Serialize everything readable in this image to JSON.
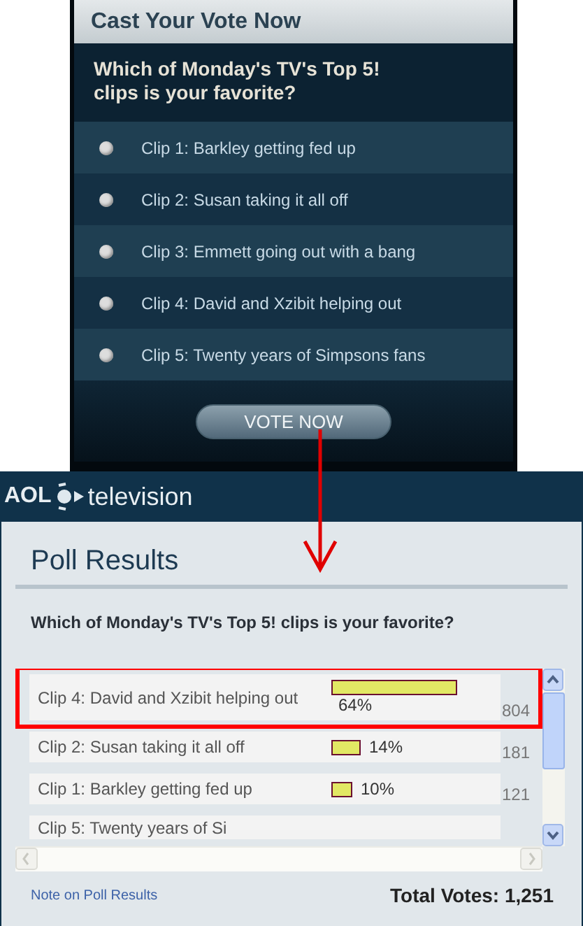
{
  "vote_panel": {
    "title": "Cast Your Vote Now",
    "question": "Which of Monday's TV's Top 5! clips is your favorite?",
    "options": [
      {
        "label": "Clip 1: Barkley getting fed up",
        "selected": false
      },
      {
        "label": "Clip 2: Susan taking it all off",
        "selected": false
      },
      {
        "label": "Clip 3: Emmett going out with a bang",
        "selected": false
      },
      {
        "label": "Clip 4: David and Xzibit helping out",
        "selected": false
      },
      {
        "label": "Clip 5: Twenty years of Simpsons fans",
        "selected": false
      }
    ],
    "button": "VOTE NOW"
  },
  "results_panel": {
    "brand": "AOL",
    "section": "television",
    "title": "Poll Results",
    "question": "Which of Monday's TV's Top 5! clips is your favorite?",
    "results": [
      {
        "label": "Clip 4: David and Xzibit helping out",
        "percent": "64%",
        "votes": "804",
        "highlighted": true
      },
      {
        "label": "Clip 2: Susan taking it all off",
        "percent": "14%",
        "votes": "181",
        "highlighted": false
      },
      {
        "label": "Clip 1: Barkley getting fed up",
        "percent": "10%",
        "votes": "121",
        "highlighted": false
      },
      {
        "label": "Clip 5: Twenty years of Si",
        "highlighted": false
      }
    ],
    "note_link": "Note on Poll Results",
    "total_votes": "Total Votes: 1,251"
  }
}
